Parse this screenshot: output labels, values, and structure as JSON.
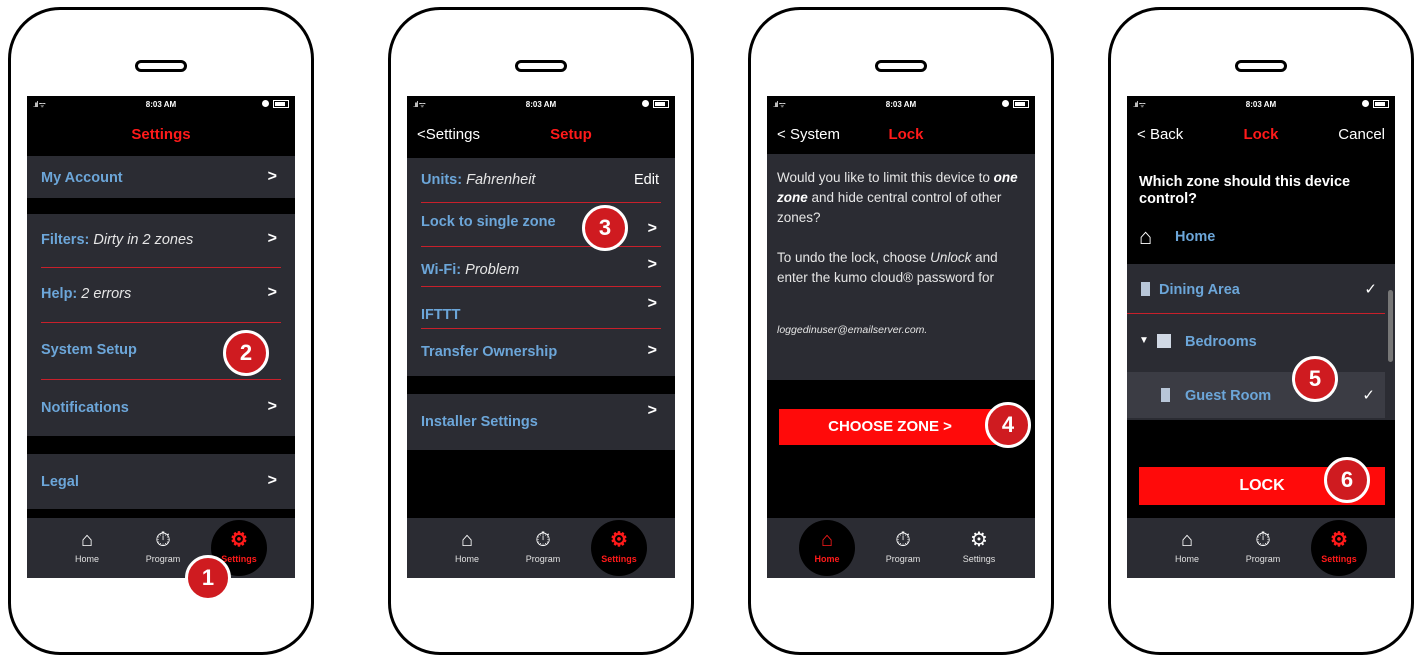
{
  "status": {
    "time": "8:03 AM"
  },
  "tabs": [
    "Home",
    "Program",
    "Settings"
  ],
  "phone1": {
    "title": "Settings",
    "rows": [
      {
        "label": "My Account",
        "value": ""
      },
      {
        "label": "Filters:",
        "value": "Dirty in 2 zones"
      },
      {
        "label": "Help:",
        "value": "2 errors"
      },
      {
        "label": "System Setup",
        "value": ""
      },
      {
        "label": "Notifications",
        "value": ""
      },
      {
        "label": "Legal",
        "value": ""
      }
    ]
  },
  "phone2": {
    "back": "Settings",
    "title": "Setup",
    "rows": [
      {
        "label": "Units:",
        "value": "Fahrenheit",
        "action": "Edit"
      },
      {
        "label": "Lock to single zone",
        "value": ""
      },
      {
        "label": "Wi-Fi:",
        "value": "Problem"
      },
      {
        "label": "IFTTT",
        "value": ""
      },
      {
        "label": "Transfer Ownership",
        "value": ""
      },
      {
        "label": "Installer Settings",
        "value": ""
      }
    ]
  },
  "phone3": {
    "back": "System",
    "title": "Lock",
    "p1_a": "Would you like to limit this device to",
    "p1_b": "one zone",
    "p1_c": "and hide central control of other zones?",
    "p2_a": "To undo the lock, choose",
    "p2_b": "Unlock",
    "p2_c": "and enter the kumo cloud® password for",
    "email": "loggedinuser@emailserver.com.",
    "button": "CHOOSE ZONE >"
  },
  "phone4": {
    "back": "Back",
    "title": "Lock",
    "cancel": "Cancel",
    "question": "Which zone should this device control?",
    "home": "Home",
    "zones": [
      "Dining Area",
      "Bedrooms",
      "Guest Room"
    ],
    "button": "LOCK"
  },
  "steps": [
    "1",
    "2",
    "3",
    "4",
    "5",
    "6"
  ],
  "colors": {
    "accent": "#ff1a1a",
    "badge": "#cf1b20",
    "link": "#6ca6d9",
    "panel": "#2b2c33"
  }
}
